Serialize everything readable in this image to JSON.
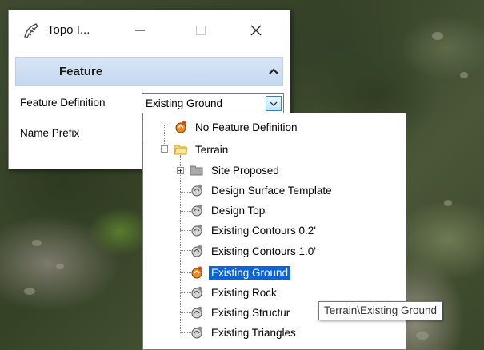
{
  "window": {
    "title": "Topo I...",
    "minimize_icon": "minimize-icon",
    "maximize_icon": "maximize-icon",
    "close_icon": "close-icon"
  },
  "section": {
    "title": "Feature",
    "collapse_icon": "chevron-up-icon"
  },
  "form": {
    "feature_definition_label": "Feature Definition",
    "feature_definition_value": "Existing Ground",
    "name_prefix_label": "Name Prefix"
  },
  "tree": {
    "items": [
      {
        "label": "No Feature Definition",
        "icon": "feature-def-icon-orange"
      },
      {
        "label": "Terrain",
        "icon": "folder-open-icon"
      },
      {
        "label": "Site Proposed",
        "icon": "folder-closed-icon"
      },
      {
        "label": "Design Surface Template",
        "icon": "feature-def-icon"
      },
      {
        "label": "Design Top",
        "icon": "feature-def-icon"
      },
      {
        "label": "Existing Contours 0.2'",
        "icon": "feature-def-icon"
      },
      {
        "label": "Existing Contours 1.0'",
        "icon": "feature-def-icon"
      },
      {
        "label": "Existing Ground",
        "icon": "feature-def-icon-orange",
        "selected": true
      },
      {
        "label": "Existing Rock",
        "icon": "feature-def-icon"
      },
      {
        "label": "Existing Structur",
        "icon": "feature-def-icon"
      },
      {
        "label": "Existing Triangles",
        "icon": "feature-def-icon"
      }
    ]
  },
  "tooltip": "Terrain\\Existing Ground",
  "colors": {
    "selection": "#0a64d8",
    "header": "#c4d8f0"
  }
}
